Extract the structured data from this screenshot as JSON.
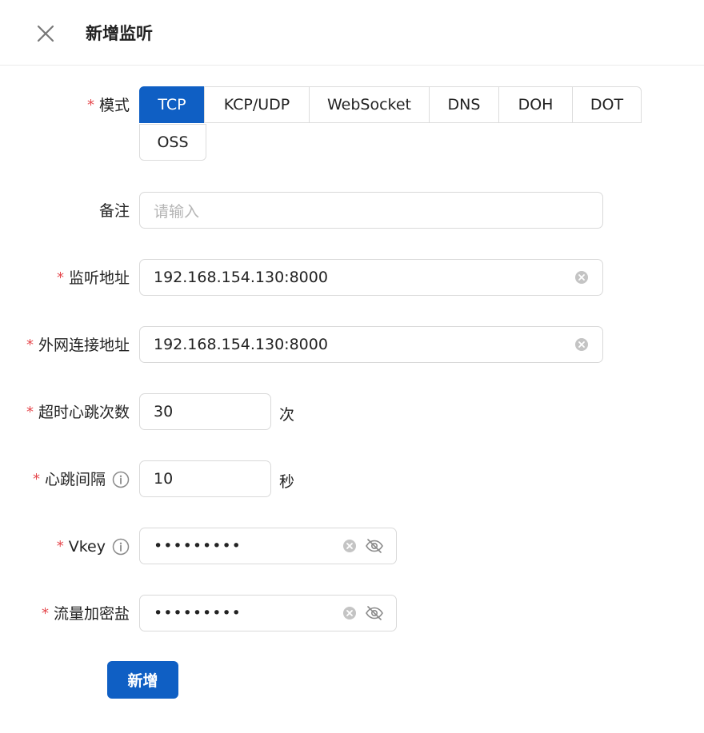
{
  "header": {
    "title": "新增监听",
    "close_icon": "close-icon"
  },
  "form": {
    "mode": {
      "label": "模式",
      "options": [
        "TCP",
        "KCP/UDP",
        "WebSocket",
        "DNS",
        "DOH",
        "DOT",
        "OSS"
      ],
      "selected": "TCP"
    },
    "remark": {
      "label": "备注",
      "placeholder": "请输入",
      "value": ""
    },
    "listen_address": {
      "label": "监听地址",
      "value": "192.168.154.130:8000"
    },
    "external_address": {
      "label": "外网连接地址",
      "value": "192.168.154.130:8000"
    },
    "heartbeat_timeout": {
      "label": "超时心跳次数",
      "value": "30",
      "unit": "次"
    },
    "heartbeat_interval": {
      "label": "心跳间隔",
      "value": "10",
      "unit": "秒"
    },
    "vkey": {
      "label": "Vkey",
      "value_masked": "•••••••••"
    },
    "traffic_salt": {
      "label": "流量加密盐",
      "value_masked": "•••••••••"
    },
    "required_mark": "*"
  },
  "actions": {
    "submit_label": "新增"
  },
  "colors": {
    "primary": "#0f5fc4",
    "required": "#e5484d",
    "border": "#d9d9d9",
    "placeholder": "#b5b5b5"
  }
}
